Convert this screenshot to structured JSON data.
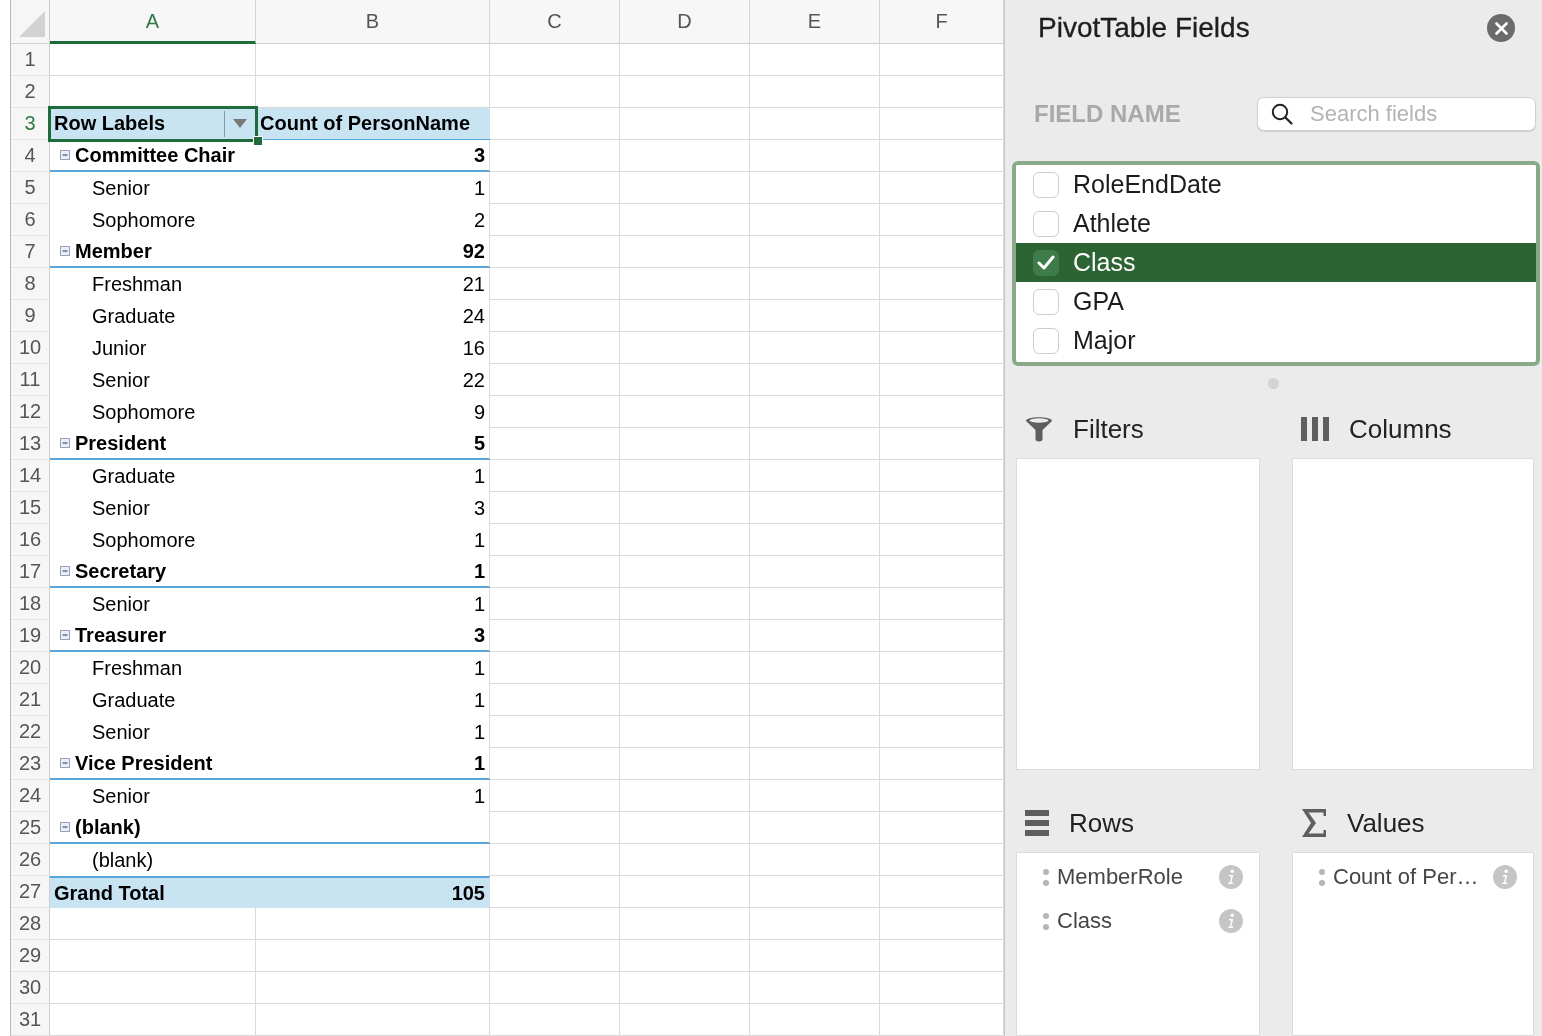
{
  "spreadsheet": {
    "columns": [
      {
        "label": "A",
        "selected": true
      },
      {
        "label": "B",
        "selected": false
      },
      {
        "label": "C",
        "selected": false
      },
      {
        "label": "D",
        "selected": false
      },
      {
        "label": "E",
        "selected": false
      },
      {
        "label": "F",
        "selected": false
      }
    ],
    "rows": [
      {
        "number": "1",
        "selected": false
      },
      {
        "number": "2",
        "selected": false
      },
      {
        "number": "3",
        "selected": true
      },
      {
        "number": "4",
        "selected": false
      },
      {
        "number": "5",
        "selected": false
      },
      {
        "number": "6",
        "selected": false
      },
      {
        "number": "7",
        "selected": false
      },
      {
        "number": "8",
        "selected": false
      },
      {
        "number": "9",
        "selected": false
      },
      {
        "number": "10",
        "selected": false
      },
      {
        "number": "11",
        "selected": false
      },
      {
        "number": "12",
        "selected": false
      },
      {
        "number": "13",
        "selected": false
      },
      {
        "number": "14",
        "selected": false
      },
      {
        "number": "15",
        "selected": false
      },
      {
        "number": "16",
        "selected": false
      },
      {
        "number": "17",
        "selected": false
      },
      {
        "number": "18",
        "selected": false
      },
      {
        "number": "19",
        "selected": false
      },
      {
        "number": "20",
        "selected": false
      },
      {
        "number": "21",
        "selected": false
      },
      {
        "number": "22",
        "selected": false
      },
      {
        "number": "23",
        "selected": false
      },
      {
        "number": "24",
        "selected": false
      },
      {
        "number": "25",
        "selected": false
      },
      {
        "number": "26",
        "selected": false
      },
      {
        "number": "27",
        "selected": false
      },
      {
        "number": "28",
        "selected": false
      },
      {
        "number": "29",
        "selected": false
      },
      {
        "number": "30",
        "selected": false
      },
      {
        "number": "31",
        "selected": false
      }
    ],
    "pivot_table": {
      "row_labels_header": "Row Labels",
      "value_header": "Count of PersonName",
      "groups": [
        {
          "label": "Committee Chair",
          "count": "3",
          "expanded": true,
          "children": [
            {
              "label": "Senior",
              "count": "1"
            },
            {
              "label": "Sophomore",
              "count": "2"
            }
          ]
        },
        {
          "label": "Member",
          "count": "92",
          "expanded": true,
          "children": [
            {
              "label": "Freshman",
              "count": "21"
            },
            {
              "label": "Graduate",
              "count": "24"
            },
            {
              "label": "Junior",
              "count": "16"
            },
            {
              "label": "Senior",
              "count": "22"
            },
            {
              "label": "Sophomore",
              "count": "9"
            }
          ]
        },
        {
          "label": "President",
          "count": "5",
          "expanded": true,
          "children": [
            {
              "label": "Graduate",
              "count": "1"
            },
            {
              "label": "Senior",
              "count": "3"
            },
            {
              "label": "Sophomore",
              "count": "1"
            }
          ]
        },
        {
          "label": "Secretary",
          "count": "1",
          "expanded": true,
          "children": [
            {
              "label": "Senior",
              "count": "1"
            }
          ]
        },
        {
          "label": "Treasurer",
          "count": "3",
          "expanded": true,
          "children": [
            {
              "label": "Freshman",
              "count": "1"
            },
            {
              "label": "Graduate",
              "count": "1"
            },
            {
              "label": "Senior",
              "count": "1"
            }
          ]
        },
        {
          "label": "Vice President",
          "count": "1",
          "expanded": true,
          "children": [
            {
              "label": "Senior",
              "count": "1"
            }
          ]
        },
        {
          "label": "(blank)",
          "expanded": true,
          "children": [
            {
              "label": "(blank)"
            }
          ]
        }
      ],
      "grand_total": {
        "label": "Grand Total",
        "count": "105"
      }
    }
  },
  "pivot_pane": {
    "title": "PivotTable Fields",
    "field_name_label": "FIELD NAME",
    "search": {
      "placeholder": "Search fields"
    },
    "fields": [
      {
        "name": "RoleEndDate",
        "checked": false,
        "selected": false
      },
      {
        "name": "Athlete",
        "checked": false,
        "selected": false
      },
      {
        "name": "Class",
        "checked": true,
        "selected": true
      },
      {
        "name": "GPA",
        "checked": false,
        "selected": false
      },
      {
        "name": "Major",
        "checked": false,
        "selected": false
      }
    ],
    "areas": [
      {
        "kind": "filters",
        "title": "Filters"
      },
      {
        "kind": "columns",
        "title": "Columns"
      },
      {
        "kind": "rows",
        "title": "Rows",
        "fields": [
          "MemberRole",
          "Class"
        ]
      },
      {
        "kind": "values",
        "title": "Values",
        "fields": [
          "Count of Per…"
        ]
      }
    ]
  }
}
